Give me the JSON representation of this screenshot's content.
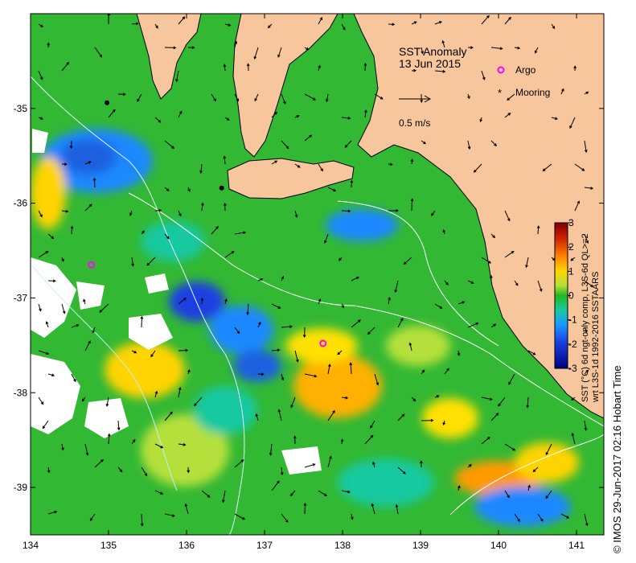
{
  "map": {
    "title": "SST Anomaly",
    "date": "13 Jun 2015",
    "x_ticks": [
      "134",
      "135",
      "136",
      "137",
      "138",
      "139",
      "140",
      "141"
    ],
    "y_ticks": [
      "-35",
      "-36",
      "-37",
      "-38",
      "-39"
    ],
    "land_color": "#F7C69C",
    "ocean_base_color": "#33B833"
  },
  "legend": {
    "argo_label": "Argo",
    "mooring_label": "Mooring",
    "argo_color": "#FF00FF",
    "mooring_color": "#000000",
    "scale_label": "0.5 m/s"
  },
  "colorbar": {
    "ticks": [
      "3",
      "2",
      "1",
      "0",
      "-1",
      "-2",
      "-3"
    ],
    "title_line1": "SST (°C) 6d ngt-only comp, L3S-6d QL>=2",
    "title_line2": "wrt L3S-1d 1992-2016 SSTAARS",
    "colors": [
      "#7f0000",
      "#d62a00",
      "#ff9a00",
      "#ffe000",
      "#9fd83a",
      "#22b81e",
      "#19c9a0",
      "#1a88ff",
      "#1626c8",
      "#000080"
    ]
  },
  "credit": "© IMOS 29-Jun-2017 02:16 Hobart Time",
  "markers": {
    "argo": [
      {
        "lon": 134.78,
        "lat": -36.65
      },
      {
        "lon": 137.75,
        "lat": -37.48
      }
    ],
    "mooring": [
      {
        "lon": 134.98,
        "lat": -34.94
      },
      {
        "lon": 136.45,
        "lat": -35.84
      }
    ]
  }
}
